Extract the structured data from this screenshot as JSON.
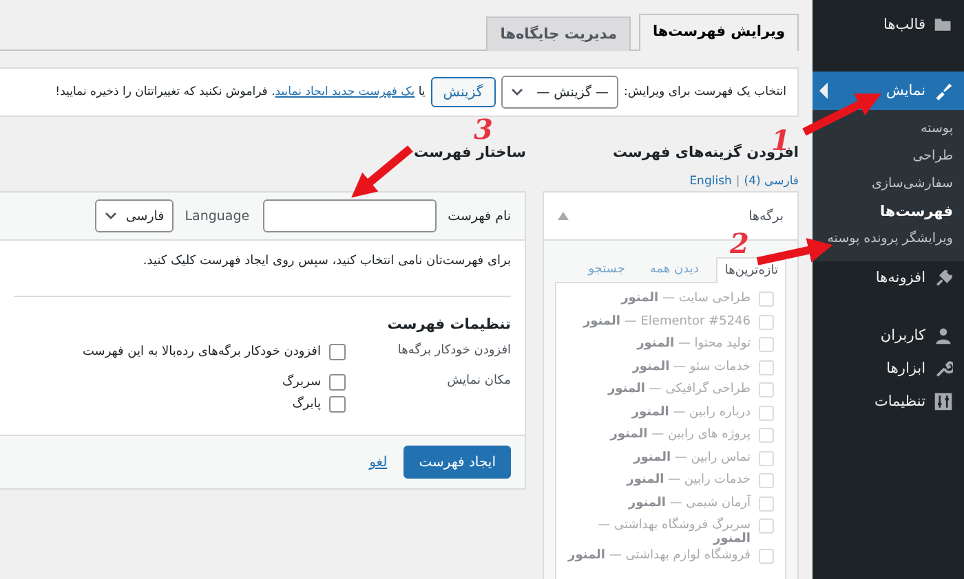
{
  "sidebar": {
    "items": [
      {
        "label": "قالب‌ها",
        "selected": false
      },
      {
        "label": "نمایش",
        "selected": true,
        "children": [
          {
            "label": "پوسته",
            "selected": false
          },
          {
            "label": "طراحی",
            "selected": false
          },
          {
            "label": "سفارشی‌سازی",
            "selected": false
          },
          {
            "label": "فهرست‌ها",
            "selected": true
          },
          {
            "label": "ویرایشگر پرونده پوسته",
            "selected": false
          }
        ]
      },
      {
        "label": "افزونه‌ها",
        "selected": false
      },
      {
        "label": "کاربران",
        "selected": false
      },
      {
        "label": "ابزارها",
        "selected": false
      },
      {
        "label": "تنظیمات",
        "selected": false
      }
    ]
  },
  "tabs": [
    {
      "label": "ویرایش فهرست‌ها",
      "selected": true
    },
    {
      "label": "مدیریت جایگاه‌ها",
      "selected": false
    }
  ],
  "menu_select": {
    "label": "انتخاب یک فهرست برای ویرایش:",
    "value": "— گزینش —",
    "button": "گزینش",
    "text_before_link": "یا",
    "link": "یک فهرست جدید ایجاد نمایید",
    "text_after_link": ". فراموش نکنید که تغییراتتان را ذخیره نمایید!"
  },
  "add_items": {
    "heading": "افزودن گزینه‌های فهرست",
    "languages": [
      "فارسی (4)",
      "English"
    ],
    "language_separator": "|",
    "pages_panel": {
      "title": "برگه‌ها",
      "expanded": true,
      "disabled": true,
      "tabs": [
        {
          "label": "تازه‌ترین‌ها",
          "selected": true
        },
        {
          "label": "دیدن همه",
          "selected": false
        },
        {
          "label": "جستجو",
          "selected": false
        }
      ],
      "items": [
        {
          "label": "طراحی سایت — **المنور**",
          "checked": false
        },
        {
          "label": "Elementor #5246 — **المنور**",
          "checked": false
        },
        {
          "label": "تولید محتوا — **المنور**",
          "checked": false
        },
        {
          "label": "خدمات سئو — **المنور**",
          "checked": false
        },
        {
          "label": "طراحی گرافیکی — **المنور**",
          "checked": false
        },
        {
          "label": "درباره رابین — **المنور**",
          "checked": false
        },
        {
          "label": "پروژه های رابین — **المنور**",
          "checked": false
        },
        {
          "label": "تماس رابین — **المنور**",
          "checked": false
        },
        {
          "label": "خدمات رابین — **المنور**",
          "checked": false
        },
        {
          "label": "آرمان شیمی — **المنور**",
          "checked": false
        },
        {
          "label": "سربرگ فروشگاه بهداشتی — **المنور**",
          "checked": false
        },
        {
          "label": "فروشگاه لوازم بهداشتی — **المنور**",
          "checked": false
        }
      ]
    }
  },
  "structure": {
    "heading": "ساختار فهرست",
    "name_label": "نام فهرست",
    "language_label": "Language",
    "language_value": "فارسی",
    "hint": "برای فهرست‌تان نامی انتخاب کنید، سپس روی ایجاد فهرست کلیک کنید.",
    "settings_heading": "تنظیمات فهرست",
    "settings": [
      {
        "label": "افزودن خودکار برگه‌ها",
        "options": [
          {
            "label": "افزودن خودکار برگه‌های رده‌بالا به این فهرست",
            "checked": false
          }
        ]
      },
      {
        "label": "مکان نمایش",
        "options": [
          {
            "label": "سربرگ",
            "checked": false
          },
          {
            "label": "پابرگ",
            "checked": false
          }
        ]
      }
    ],
    "create_button": "ایجاد فهرست",
    "cancel_link": "لغو"
  },
  "annotations": [
    {
      "number": "1"
    },
    {
      "number": "2"
    },
    {
      "number": "3"
    }
  ]
}
